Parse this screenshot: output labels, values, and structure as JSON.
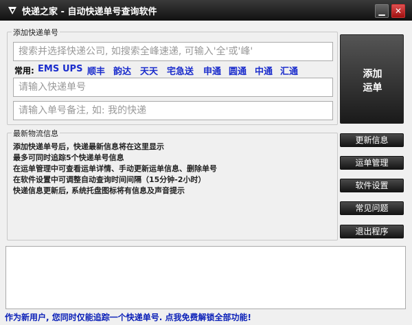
{
  "window": {
    "title": "快递之家 - 自动快递单号查询软件",
    "controls": {
      "minimize": "▁",
      "close": "✕"
    }
  },
  "add_group": {
    "label": "添加快递单号",
    "search_placeholder": "搜索并选择快递公司, 如搜索全峰速递, 可输入'全'或'峰'",
    "quick_label": "常用:",
    "couriers": [
      "EMS",
      "UPS",
      "顺丰",
      "韵达",
      "天天",
      "宅急送",
      "申通",
      "圆通",
      "中通",
      "汇通"
    ],
    "number_placeholder": "请输入快递单号",
    "note_placeholder": "请输入单号备注, 如: 我的快递"
  },
  "add_button": {
    "line1": "添加",
    "line2": "运单"
  },
  "info_group": {
    "label": "最新物流信息",
    "lines": [
      "添加快递单号后，快递最新信息将在这里显示",
      "最多可同时追踪5个快递单号信息",
      "在运单管理中可查看运单详情、手动更新运单信息、删除单号",
      "在软件设置中可调整自动查询时间间隔（15分钟-2小时）",
      "快递信息更新后, 系统托盘图标将有信息及声音提示"
    ]
  },
  "side_buttons": [
    "更新信息",
    "运单管理",
    "软件设置",
    "常见问题",
    "退出程序"
  ],
  "footer": {
    "text": "作为新用户, 您同时仅能追踪一个快递单号. 点我免费解锁全部功能!"
  },
  "colors": {
    "titlebar": "#1a1a1a",
    "courier_link": "#1a2ccc",
    "footer_link": "#0a1fb8"
  }
}
